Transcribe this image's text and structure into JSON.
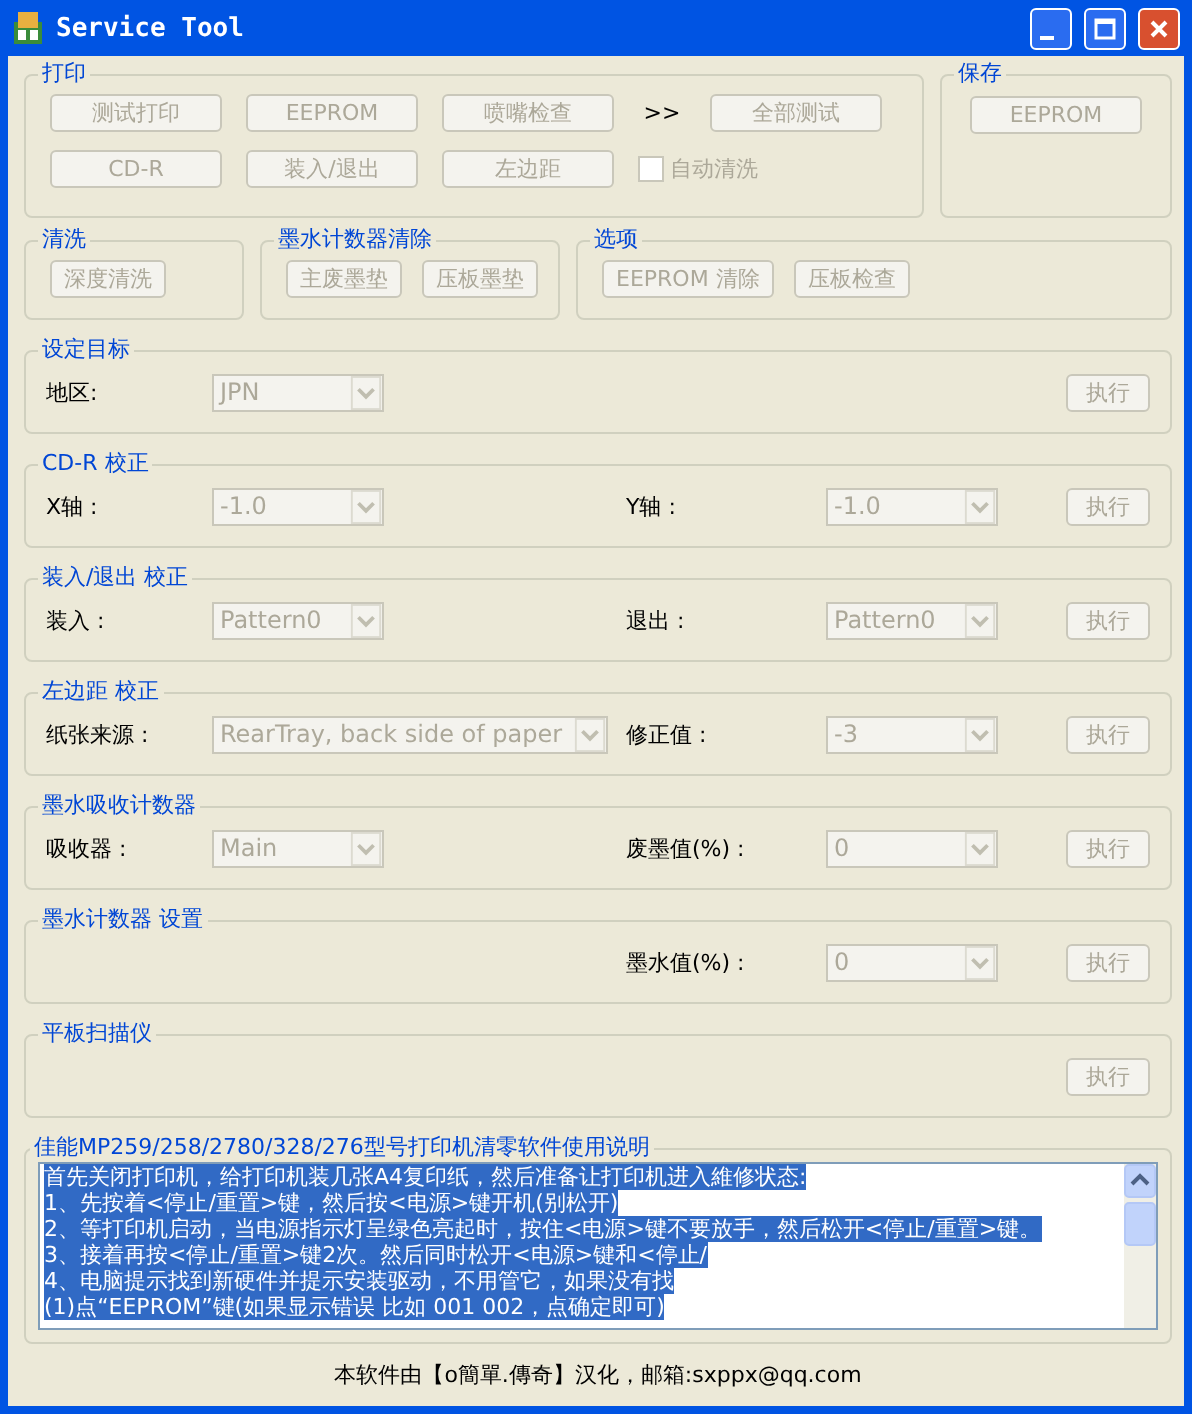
{
  "window": {
    "title": "Service Tool"
  },
  "top_groups": [
    {
      "title": "打印",
      "items": [
        {
          "kind": "button",
          "label": "测试打印",
          "disabled": true
        },
        {
          "kind": "button",
          "label": "EEPROM",
          "disabled": true
        },
        {
          "kind": "button",
          "label": "喷嘴检查",
          "disabled": true
        },
        {
          "kind": "text",
          "label": ">>"
        },
        {
          "kind": "button",
          "label": "全部测试",
          "disabled": true
        },
        {
          "kind": "button",
          "label": "CD-R",
          "disabled": true
        },
        {
          "kind": "button",
          "label": "装入/退出",
          "disabled": true
        },
        {
          "kind": "button",
          "label": "左边距",
          "disabled": true
        },
        {
          "kind": "checkbox",
          "label": "自动清洗",
          "checked": false,
          "disabled": true
        }
      ]
    },
    {
      "title": "保存",
      "items": [
        {
          "kind": "button",
          "label": "EEPROM",
          "disabled": true
        }
      ]
    },
    {
      "title": "清洗",
      "items": [
        {
          "kind": "button",
          "label": "深度清洗",
          "disabled": true
        }
      ]
    },
    {
      "title": "墨水计数器清除",
      "items": [
        {
          "kind": "button",
          "label": "主废墨垫",
          "disabled": true
        },
        {
          "kind": "button",
          "label": "压板墨垫",
          "disabled": true
        }
      ]
    },
    {
      "title": "选项",
      "items": [
        {
          "kind": "button",
          "label": "EEPROM 清除",
          "disabled": true
        },
        {
          "kind": "button",
          "label": "压板检查",
          "disabled": true
        }
      ]
    }
  ],
  "settings_groups": [
    {
      "title": "设定目标",
      "left": {
        "label": "地区:",
        "value": "JPN",
        "disabled": true
      },
      "execute": {
        "label": "执行",
        "disabled": true
      }
    },
    {
      "title": "CD-R 校正",
      "left": {
        "label": "X轴 :",
        "value": "-1.0",
        "disabled": true
      },
      "right": {
        "label": "Y轴 :",
        "value": "-1.0",
        "disabled": true
      },
      "execute": {
        "label": "执行",
        "disabled": true
      }
    },
    {
      "title": "装入/退出 校正",
      "left": {
        "label": "装入 :",
        "value": "Pattern0",
        "disabled": true
      },
      "right": {
        "label": "退出 :",
        "value": "Pattern0",
        "disabled": true
      },
      "execute": {
        "label": "执行",
        "disabled": true
      }
    },
    {
      "title": "左边距 校正",
      "left": {
        "label": "纸张来源 :",
        "value": "RearTray, back side of paper",
        "disabled": true
      },
      "right": {
        "label": "修正值 :",
        "value": "-3",
        "disabled": true
      },
      "execute": {
        "label": "执行",
        "disabled": true
      }
    },
    {
      "title": "墨水吸收计数器",
      "left": {
        "label": "吸收器 :",
        "value": "Main",
        "disabled": true
      },
      "right": {
        "label": "废墨值(%) :",
        "value": "0",
        "disabled": true
      },
      "execute": {
        "label": "执行",
        "disabled": true
      }
    },
    {
      "title": "墨水计数器 设置",
      "right": {
        "label": "墨水值(%) :",
        "value": "0",
        "disabled": true
      },
      "execute": {
        "label": "执行",
        "disabled": true
      }
    },
    {
      "title": "平板扫描仪",
      "execute": {
        "label": "执行",
        "disabled": true
      }
    }
  ],
  "manual": {
    "title": "佳能MP259/258/2780/328/276型号打印机清零软件使用说明",
    "lines": [
      {
        "text": "首先关闭打印机，给打印机装几张A4复印纸，然后准备让打印机进入維修状态:",
        "selected": true
      },
      {
        "text": "1、先按着<停止/重置>键，然后按<电源>键开机(别松开)",
        "selected": true
      },
      {
        "text": "2、等打印机启动，当电源指示灯呈绿色亮起时，按住<电源>键不要放手，然后松开<停止/重置>键。",
        "selected": true
      },
      {
        "text": "3、接着再按<停止/重置>键2次。然后同时松开<电源>键和<停止/",
        "selected": true
      },
      {
        "text": "4、电脑提示找到新硬件并提示安装驱动，不用管它，如果没有找",
        "selected": true
      },
      {
        "text": "(1)点“EEPROM”键(如果显示错误  比如 001  002，点确定即可)",
        "selected": true
      }
    ]
  },
  "footer": "本软件由【o簡單.傳奇】汉化，邮箱:sxppx@qq.com"
}
